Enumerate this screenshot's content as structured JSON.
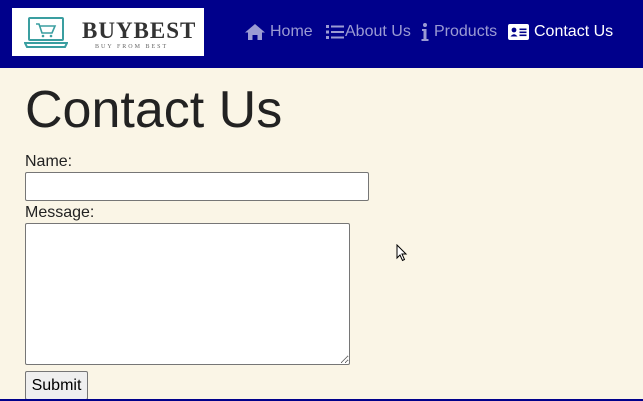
{
  "brand": {
    "name": "BUYBEST",
    "tagline": "BUY FROM BEST"
  },
  "nav": {
    "items": [
      {
        "label": "Home",
        "icon": "home-icon"
      },
      {
        "label": "About Us",
        "icon": "list-icon"
      },
      {
        "label": "Products",
        "icon": "info-icon"
      },
      {
        "label": "Contact Us",
        "icon": "contact-card-icon",
        "active": true
      }
    ]
  },
  "page": {
    "title": "Contact Us"
  },
  "form": {
    "name_label": "Name:",
    "name_value": "",
    "message_label": "Message:",
    "message_value": "",
    "submit_label": "Submit"
  },
  "colors": {
    "navbar": "#00008b",
    "nav_link": "#9b9bd3",
    "nav_link_active": "#ffffff",
    "page_background": "#faf5e6",
    "logo_teal": "#3a9ea0"
  }
}
